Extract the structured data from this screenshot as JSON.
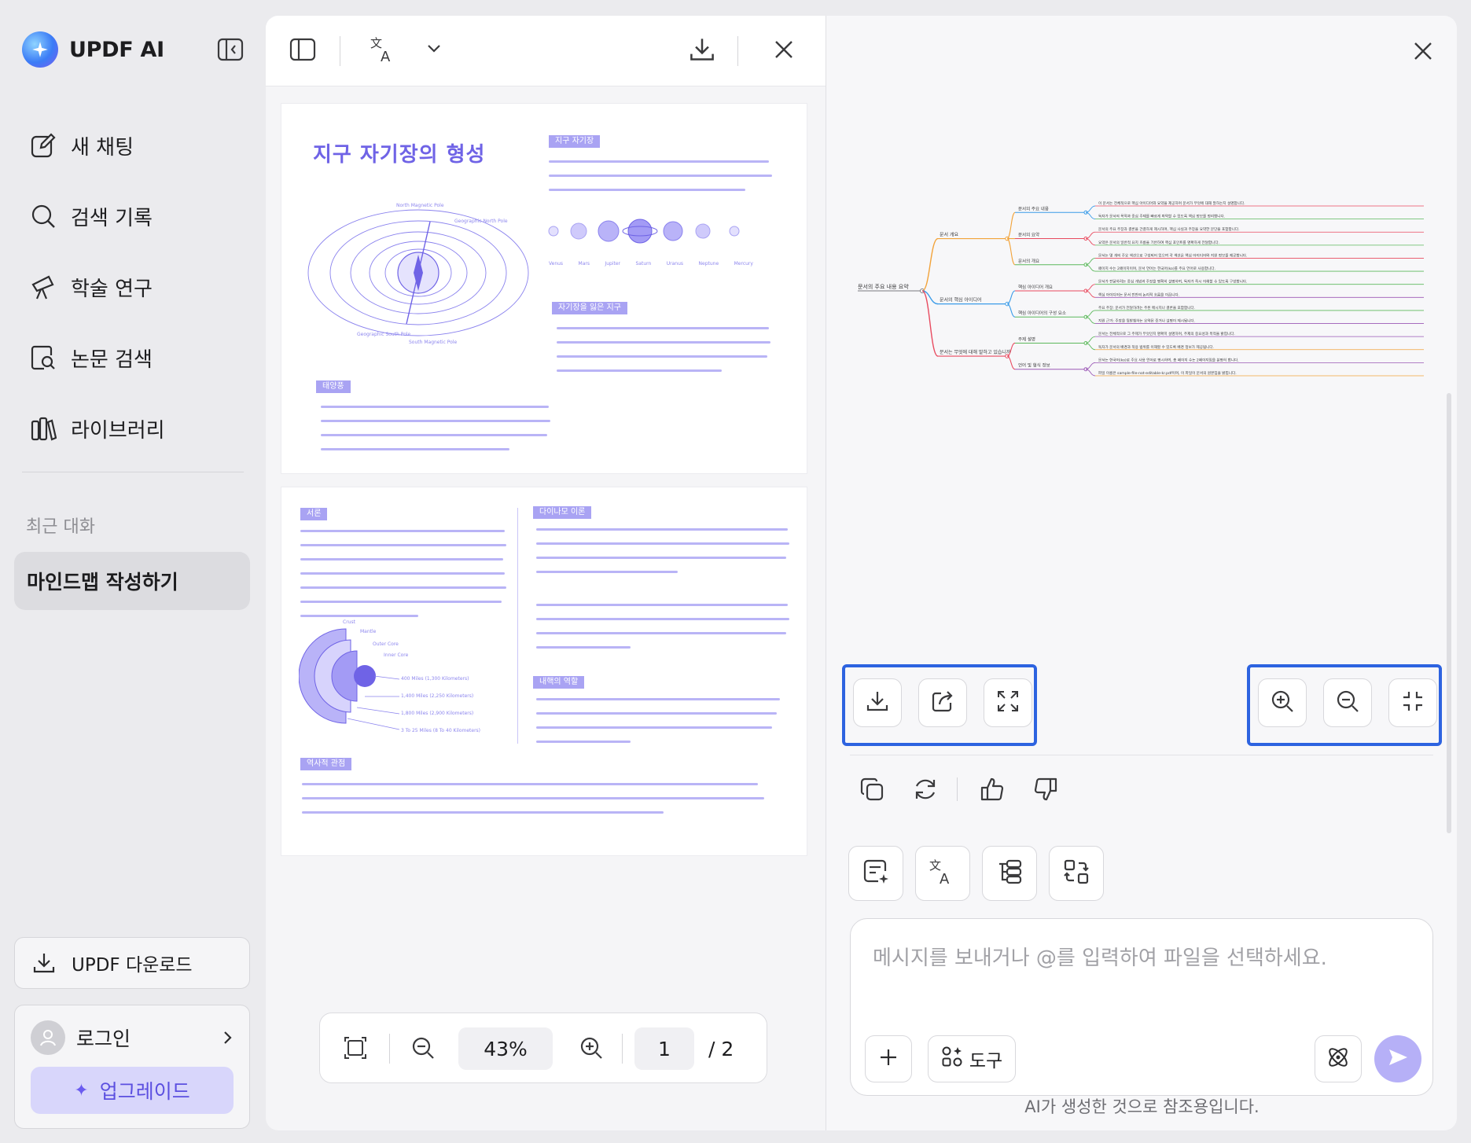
{
  "sidebar": {
    "brand": "UPDF AI",
    "nav": [
      {
        "label": "새 채팅",
        "icon": "edit-icon"
      },
      {
        "label": "검색 기록",
        "icon": "search-icon"
      },
      {
        "label": "학술 연구",
        "icon": "telescope-icon"
      },
      {
        "label": "논문 검색",
        "icon": "paper-search-icon"
      },
      {
        "label": "라이브러리",
        "icon": "library-icon"
      }
    ],
    "recent_title": "최근 대화",
    "recent_items": [
      "마인드맵 작성하기"
    ],
    "download_label": "UPDF 다운로드",
    "login_label": "로그인",
    "upgrade_label": "업그레이드"
  },
  "pdf": {
    "page1": {
      "title": "지구 자기장의 형성",
      "sections": [
        "지구 자기장",
        "자기장을 잃은 지구",
        "태양풍"
      ],
      "magnet_labels": [
        "North Magnetic Pole",
        "Geographic North Pole",
        "Geographic South Pole",
        "South Magnetic Pole"
      ],
      "planet_labels": [
        "Venus",
        "Mars",
        "Jupiter",
        "Saturn",
        "Uranus",
        "Neptune",
        "Mercury"
      ]
    },
    "page2": {
      "sections": [
        "서론",
        "다이나모 이론",
        "내핵의 역할",
        "역사적 관점"
      ],
      "core_labels": [
        "Crust",
        "Mantle",
        "Outer Core",
        "Inner Core"
      ],
      "depth_labels": [
        "400 Miles (1,300 Kilometers)",
        "1,400 Miles (2,250 Kilometers)",
        "1,800 Miles (2,900 Kilometers)",
        "3 To 25 Miles (8 To 40 Kilometers)"
      ]
    },
    "zoom": "43%",
    "current_page": "1",
    "total_pages": "/ 2"
  },
  "mindmap": {
    "root": "문서의 주요 내용 요약",
    "branches": [
      {
        "label": "문서 개요",
        "children": [
          {
            "label": "문서의 주요 내용",
            "leaves": [
              "이 문서는 전체적으로 핵심 아이디어와 요약을 제공하며 문서가 무엇에 대해 말하는지 설명합니다.",
              "독자가 문서의 목적과 중심 주제를 빠르게 파악할 수 있도록 핵심 정보를 정리합니다."
            ]
          },
          {
            "label": "문서의 요약",
            "leaves": [
              "문서의 주요 주장과 결론을 간결하게 제시하며, 핵심 사실과 주장을 요약한 문단을 포함합니다.",
              "요약은 문서의 일반적 요지 흐름을 기반하여 핵심 포인트를 명확하게 전달합니다."
            ]
          },
          {
            "label": "문서의 개요",
            "leaves": [
              "문서는 몇 개의 주요 섹션으로 구성되어 있으며 각 섹션은 핵심 아이디어와 지원 정보를 제공합니다.",
              "페이지 수는 2페이지이며, 문서 언어는 한국어(ko)를 주요 언어로 사용합니다."
            ]
          }
        ]
      },
      {
        "label": "문서의 핵심 아이디어",
        "children": [
          {
            "label": "핵심 아이디어 개요",
            "leaves": [
              "문서가 전달하려는 중심 개념과 주장을 명확히 설명하며, 독자가 즉시 이해할 수 있도록 구성합니다.",
              "핵심 아이디어는 문서 전반의 논리적 흐름을 이끕니다."
            ]
          },
          {
            "label": "핵심 아이디어의 구성 요소",
            "leaves": [
              "주요 주장: 문서가 전달하려는 주된 메시지나 결론을 포함합니다.",
              "지원 근거: 주장을 뒷받침하는 요약된 증거나 설명이 제시됩니다."
            ]
          }
        ]
      },
      {
        "label": "문서는 무엇에 대해 말하고 있습니까",
        "children": [
          {
            "label": "주제 설명",
            "leaves": [
              "문서는 전체적으로 그 주제가 무엇인지 명확히 설명하며, 주제의 중요성과 목적을 밝힙니다.",
              "독자가 문서의 배경과 적용 범위를 이해할 수 있도록 배경 정보가 제공됩니다."
            ]
          },
          {
            "label": "언어 및 형식 정보",
            "leaves": [
              "문서는 한국어(ko)로 주요 사용 언어로 명시하며, 총 페이지 수는 2페이지임을 분명히 합니다.",
              "파일 이름은 sample-file-not-editable-kr.pdf이며, 이 파일이 문서의 원본임을 밝힙니다."
            ]
          }
        ]
      }
    ]
  },
  "ai": {
    "input_placeholder": "메시지를 보내거나 @를 입력하여 파일을 선택하세요.",
    "tools_label": "도구",
    "disclaimer": "AI가 생성한 것으로 참조용입니다."
  },
  "colors": {
    "accent": "#6b5cf0",
    "highlight_border": "#2d63e0",
    "branch_colors": [
      "#f2a33a",
      "#3a9be8",
      "#e84a5f",
      "#5cb85c",
      "#9b59b6"
    ]
  }
}
